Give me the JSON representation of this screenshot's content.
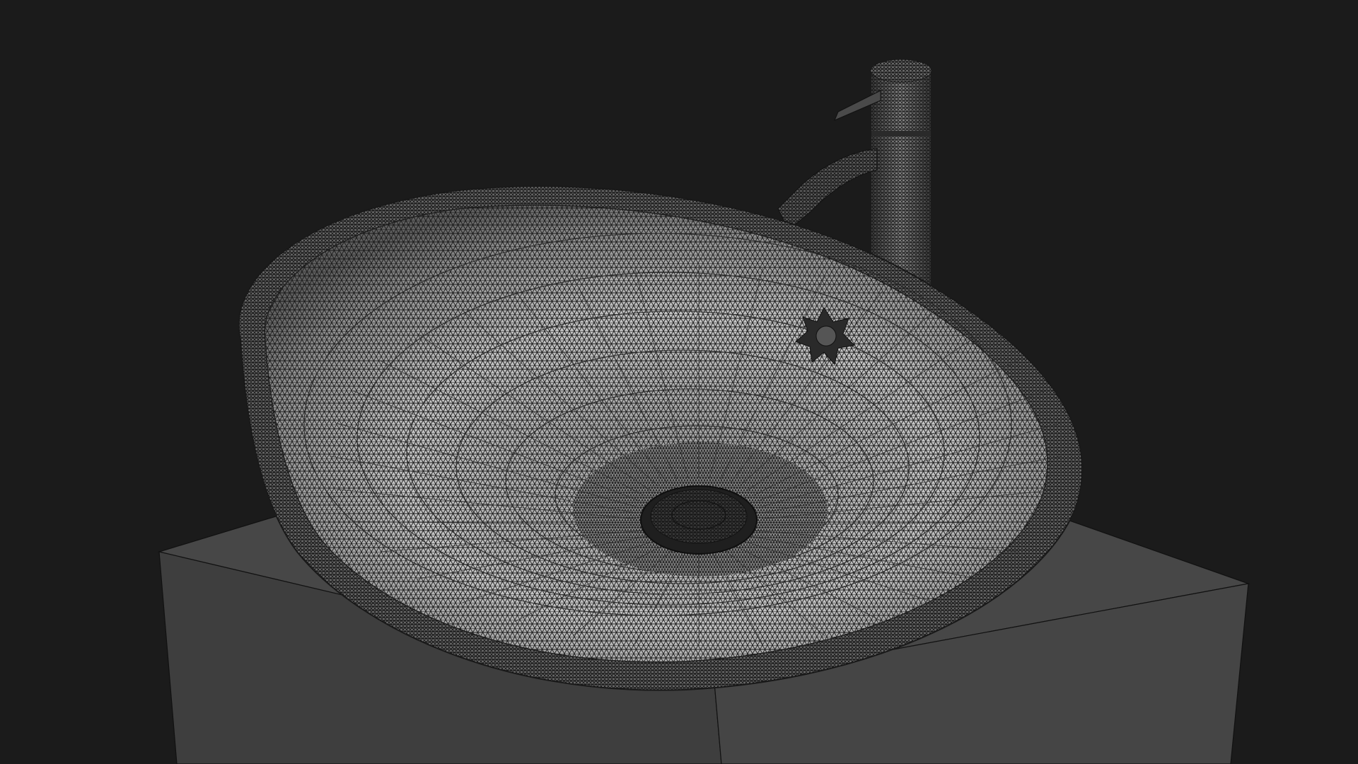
{
  "scene": {
    "subject": "wireframe-render",
    "objects": [
      "vessel-sink",
      "faucet",
      "drain",
      "vanity-cabinet"
    ]
  },
  "colors": {
    "background": "#1b1b1b",
    "cabinet_top": "#464646",
    "cabinet_front": "#3f3f3f",
    "cabinet_side": "#454545",
    "cabinet_edge": "#111111",
    "sink_fill": "#6a6a6a",
    "sink_inner": "#8a8a8a",
    "sink_bowl_light": "#b9b9b9",
    "wire": "#1a1a1a",
    "faucet": "#5d5d5d",
    "drain": "#2a2a2a"
  },
  "mesh": {
    "type": "triangle-wireframe",
    "density": "high"
  }
}
